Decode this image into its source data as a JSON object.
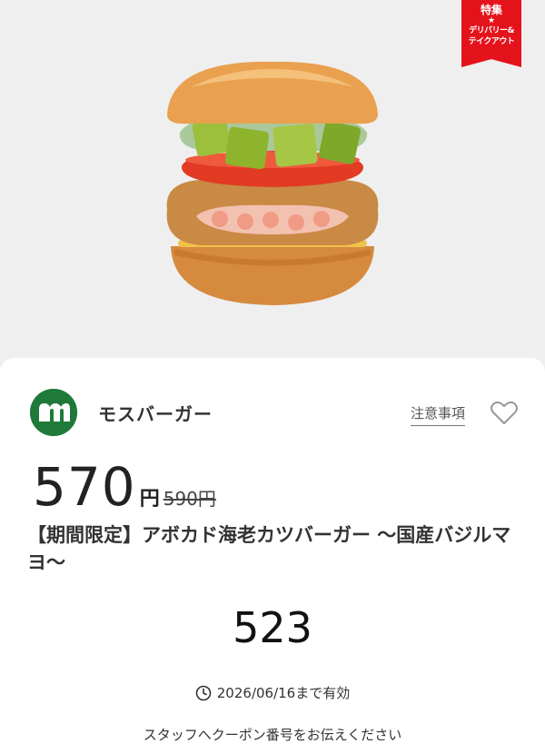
{
  "badge": {
    "title": "特集",
    "star": "★",
    "line1": "デリバリー&",
    "line2": "テイクアウト",
    "color": "#e4121b"
  },
  "product_image": {
    "icon": "burger-image"
  },
  "brand": {
    "name": "モスバーガー",
    "logo_color": "#1f7a3a",
    "logo_icon": "mos-logo-icon"
  },
  "actions": {
    "notice_label": "注意事項",
    "favorite_icon": "heart-icon"
  },
  "price": {
    "current": "570",
    "currency": "円",
    "original": "590円"
  },
  "product": {
    "title": "【期間限定】アボカド海老カツバーガー ～国産バジルマヨ～"
  },
  "coupon": {
    "code": "523"
  },
  "validity": {
    "text": "2026/06/16まで有効",
    "icon": "clock-icon"
  },
  "instruction": "スタッフへクーポン番号をお伝えください"
}
